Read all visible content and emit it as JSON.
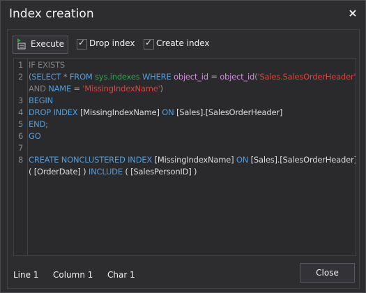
{
  "dialog": {
    "title": "Index creation",
    "close_icon": "×"
  },
  "toolbar": {
    "execute_label": "Execute",
    "drop_index_label": "Drop index",
    "drop_index_checked": true,
    "create_index_label": "Create index",
    "create_index_checked": true
  },
  "editor": {
    "line_numbers": [
      "1",
      "2",
      "3",
      "4",
      "5",
      "6",
      "7",
      "8"
    ],
    "l1": {
      "a": "IF EXISTS"
    },
    "l2": {
      "a": "(",
      "b": "SELECT",
      "c": " * ",
      "d": "FROM",
      "e": " ",
      "f": "sys.indexes",
      "g": " ",
      "h": "WHERE",
      "i": " object_id ",
      "j": "=",
      "k": " ",
      "l": "object_id",
      "m": "(",
      "n": "'Sales.SalesOrderHeader'",
      "o": ")"
    },
    "l3": {
      "a": "AND",
      "b": " ",
      "c": "NAME",
      "d": " = ",
      "e": "'MissingIndexName'",
      "f": ")"
    },
    "l4": {
      "a": "BEGIN"
    },
    "l5": {
      "a": "DROP INDEX",
      "b": " [MissingIndexName] ",
      "c": "ON",
      "d": " [Sales].[SalesOrderHeader]"
    },
    "l6": {
      "a": "END",
      "b": ";"
    },
    "l7": {
      "a": "GO"
    },
    "l8": {
      "a": "CREATE NONCLUSTERED INDEX",
      "b": " [MissingIndexName] ",
      "c": "ON",
      "d": " [Sales].[SalesOrderHeader]"
    },
    "l9": {
      "a": "( [OrderDate] ) ",
      "b": "INCLUDE",
      "c": " ( [SalesPersonID] )"
    }
  },
  "status": {
    "line": "Line 1",
    "column": "Column 1",
    "char": "Char 1"
  },
  "footer": {
    "close_label": "Close"
  },
  "colors": {
    "keyword": "#569cd6",
    "comment": "#808080",
    "system": "#2ea44f",
    "function": "#d18fdb",
    "string": "#d64541",
    "background": "#2d2d30"
  }
}
